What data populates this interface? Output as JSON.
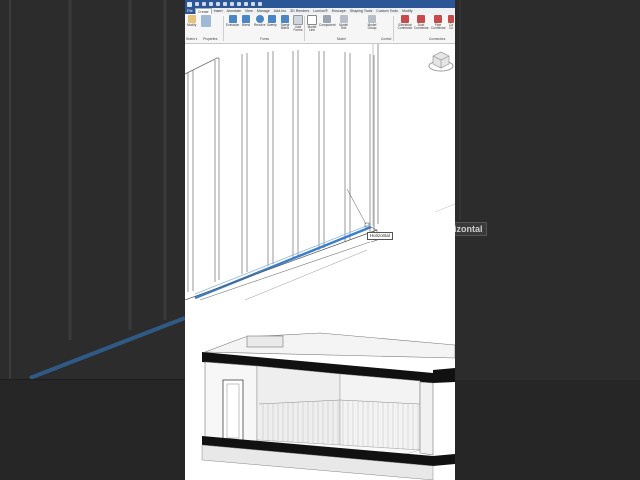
{
  "quick_access": {
    "icons": [
      "file-icon",
      "open-icon",
      "save-icon",
      "sync-icon",
      "undo-icon",
      "redo-icon",
      "print-icon",
      "measure-icon",
      "text-icon",
      "3d-view-icon",
      "close-icon"
    ]
  },
  "tabs": [
    {
      "label": "File"
    },
    {
      "label": "Create"
    },
    {
      "label": "Insert"
    },
    {
      "label": "Annotate"
    },
    {
      "label": "View"
    },
    {
      "label": "Manage"
    },
    {
      "label": "Add-Ins"
    },
    {
      "label": "3D Renders"
    },
    {
      "label": "Lumion®"
    },
    {
      "label": "Enscape"
    },
    {
      "label": "Shaping Tools"
    },
    {
      "label": "Custom Tools"
    },
    {
      "label": "Modify"
    }
  ],
  "ribbon": {
    "tools": [
      {
        "label": "Modify",
        "icon": "cursor-icon",
        "color": "#d9a74a"
      },
      {
        "label": "Extrusion",
        "icon": "extrusion-icon",
        "color": "#4a86c5"
      },
      {
        "label": "Blend",
        "icon": "blend-icon",
        "color": "#4a86c5"
      },
      {
        "label": "Revolve",
        "icon": "revolve-icon",
        "color": "#4a86c5"
      },
      {
        "label": "Sweep",
        "icon": "sweep-icon",
        "color": "#4a86c5"
      },
      {
        "label": "Swept Blend",
        "icon": "swept-blend-icon",
        "color": "#4a86c5"
      },
      {
        "label": "Void Forms",
        "icon": "void-forms-icon",
        "color": "#cfd5dd"
      },
      {
        "label": "Model Line",
        "icon": "model-line-icon",
        "color": "#888888"
      },
      {
        "label": "Component",
        "icon": "component-icon",
        "color": "#9aa5b1"
      },
      {
        "label": "Model Text",
        "icon": "model-text-icon",
        "color": "#9aa5b1"
      },
      {
        "label": "Model Group",
        "icon": "model-group-icon",
        "color": "#9aa5b1"
      },
      {
        "label": "Electrical Connector",
        "icon": "electrical-connector-icon",
        "color": "#c74b4b"
      },
      {
        "label": "Duct Connector",
        "icon": "duct-connector-icon",
        "color": "#c74b4b"
      },
      {
        "label": "Pipe Connector",
        "icon": "pipe-connector-icon",
        "color": "#c74b4b"
      },
      {
        "label": "Ca Co",
        "icon": "cable-connector-icon",
        "color": "#c74b4b"
      }
    ],
    "panels": [
      {
        "label": "Select ▾"
      },
      {
        "label": "Properties"
      },
      {
        "label": "Forms"
      },
      {
        "label": "Model"
      },
      {
        "label": "Control"
      },
      {
        "label": "Connectors"
      }
    ]
  },
  "viewport": {
    "tooltip": "Horizontal"
  },
  "background_overlay": {
    "label": "izontal"
  },
  "colors": {
    "accent": "#2b5797",
    "selection": "#3a7fc9"
  }
}
